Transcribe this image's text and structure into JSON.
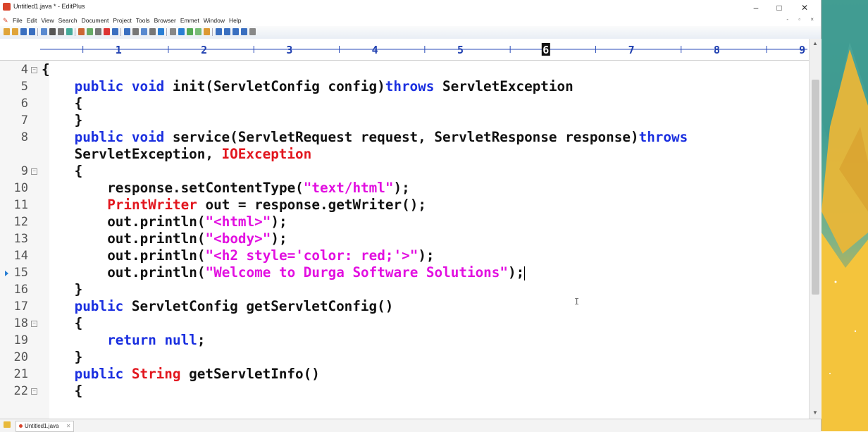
{
  "window": {
    "title": "Untitled1.java * - EditPlus",
    "controls": {
      "minimize": "–",
      "maximize": "□",
      "close": "✕"
    }
  },
  "menu": {
    "items": [
      "File",
      "Edit",
      "View",
      "Search",
      "Document",
      "Project",
      "Tools",
      "Browser",
      "Emmet",
      "Window",
      "Help"
    ],
    "mdi_controls": "- ▫ ×"
  },
  "ruler": {
    "marks": [
      "1",
      "2",
      "3",
      "4",
      "5",
      "6",
      "7",
      "8",
      "9"
    ],
    "highlighted": "6"
  },
  "editor": {
    "lines": [
      {
        "num": "4",
        "fold": true,
        "indent": 0,
        "tokens": [
          {
            "t": "{",
            "c": ""
          }
        ]
      },
      {
        "num": "5",
        "fold": false,
        "indent": 1,
        "tokens": [
          {
            "t": "public void ",
            "c": "kw"
          },
          {
            "t": "init(ServletConfig config)",
            "c": ""
          },
          {
            "t": "throws ",
            "c": "kw"
          },
          {
            "t": "ServletException",
            "c": ""
          }
        ]
      },
      {
        "num": "6",
        "fold": false,
        "indent": 1,
        "tokens": [
          {
            "t": "{",
            "c": ""
          }
        ]
      },
      {
        "num": "7",
        "fold": false,
        "indent": 1,
        "tokens": [
          {
            "t": "}",
            "c": ""
          }
        ]
      },
      {
        "num": "8",
        "fold": false,
        "indent": 1,
        "tokens": [
          {
            "t": "public void ",
            "c": "kw"
          },
          {
            "t": "service(ServletRequest request, ServletResponse response)",
            "c": ""
          },
          {
            "t": "throws",
            "c": "kw"
          }
        ]
      },
      {
        "num": "",
        "fold": false,
        "indent": 1,
        "tokens": [
          {
            "t": "ServletException, ",
            "c": ""
          },
          {
            "t": "IOException",
            "c": "cls"
          }
        ]
      },
      {
        "num": "9",
        "fold": true,
        "indent": 1,
        "tokens": [
          {
            "t": "{",
            "c": ""
          }
        ]
      },
      {
        "num": "10",
        "fold": false,
        "indent": 2,
        "tokens": [
          {
            "t": "response.setContentType(",
            "c": ""
          },
          {
            "t": "\"text/html\"",
            "c": "str"
          },
          {
            "t": ");",
            "c": ""
          }
        ]
      },
      {
        "num": "11",
        "fold": false,
        "indent": 2,
        "tokens": [
          {
            "t": "PrintWriter",
            "c": "cls"
          },
          {
            "t": " out = response.getWriter();",
            "c": ""
          }
        ]
      },
      {
        "num": "12",
        "fold": false,
        "indent": 2,
        "tokens": [
          {
            "t": "out.println(",
            "c": ""
          },
          {
            "t": "\"<html>\"",
            "c": "str"
          },
          {
            "t": ");",
            "c": ""
          }
        ]
      },
      {
        "num": "13",
        "fold": false,
        "indent": 2,
        "tokens": [
          {
            "t": "out.println(",
            "c": ""
          },
          {
            "t": "\"<body>\"",
            "c": "str"
          },
          {
            "t": ");",
            "c": ""
          }
        ]
      },
      {
        "num": "14",
        "fold": false,
        "indent": 2,
        "tokens": [
          {
            "t": "out.println(",
            "c": ""
          },
          {
            "t": "\"<h2 style='color: red;'>\"",
            "c": "str"
          },
          {
            "t": ");",
            "c": ""
          }
        ]
      },
      {
        "num": "15",
        "fold": false,
        "indent": 2,
        "current": true,
        "tokens": [
          {
            "t": "out.println(",
            "c": ""
          },
          {
            "t": "\"Welcome to Durga Software Solutions\"",
            "c": "str"
          },
          {
            "t": ");",
            "c": ""
          }
        ]
      },
      {
        "num": "16",
        "fold": false,
        "indent": 1,
        "tokens": [
          {
            "t": "}",
            "c": ""
          }
        ]
      },
      {
        "num": "17",
        "fold": false,
        "indent": 1,
        "tokens": [
          {
            "t": "public ",
            "c": "kw"
          },
          {
            "t": "ServletConfig getServletConfig()",
            "c": ""
          }
        ]
      },
      {
        "num": "18",
        "fold": true,
        "indent": 1,
        "tokens": [
          {
            "t": "{",
            "c": ""
          }
        ]
      },
      {
        "num": "19",
        "fold": false,
        "indent": 2,
        "tokens": [
          {
            "t": "return null",
            "c": "kw"
          },
          {
            "t": ";",
            "c": ""
          }
        ]
      },
      {
        "num": "20",
        "fold": false,
        "indent": 1,
        "tokens": [
          {
            "t": "}",
            "c": ""
          }
        ]
      },
      {
        "num": "21",
        "fold": false,
        "indent": 1,
        "tokens": [
          {
            "t": "public ",
            "c": "kw"
          },
          {
            "t": "String",
            "c": "cls"
          },
          {
            "t": " getServletInfo()",
            "c": ""
          }
        ]
      },
      {
        "num": "22",
        "fold": true,
        "indent": 1,
        "tokens": [
          {
            "t": "{",
            "c": ""
          }
        ]
      }
    ]
  },
  "tabs": [
    {
      "label": "Untitled1.java",
      "close": "✕"
    }
  ],
  "colors": {
    "keyword": "#1a2fe0",
    "string": "#e20fe0",
    "class": "#e2161e",
    "text": "#111111"
  }
}
